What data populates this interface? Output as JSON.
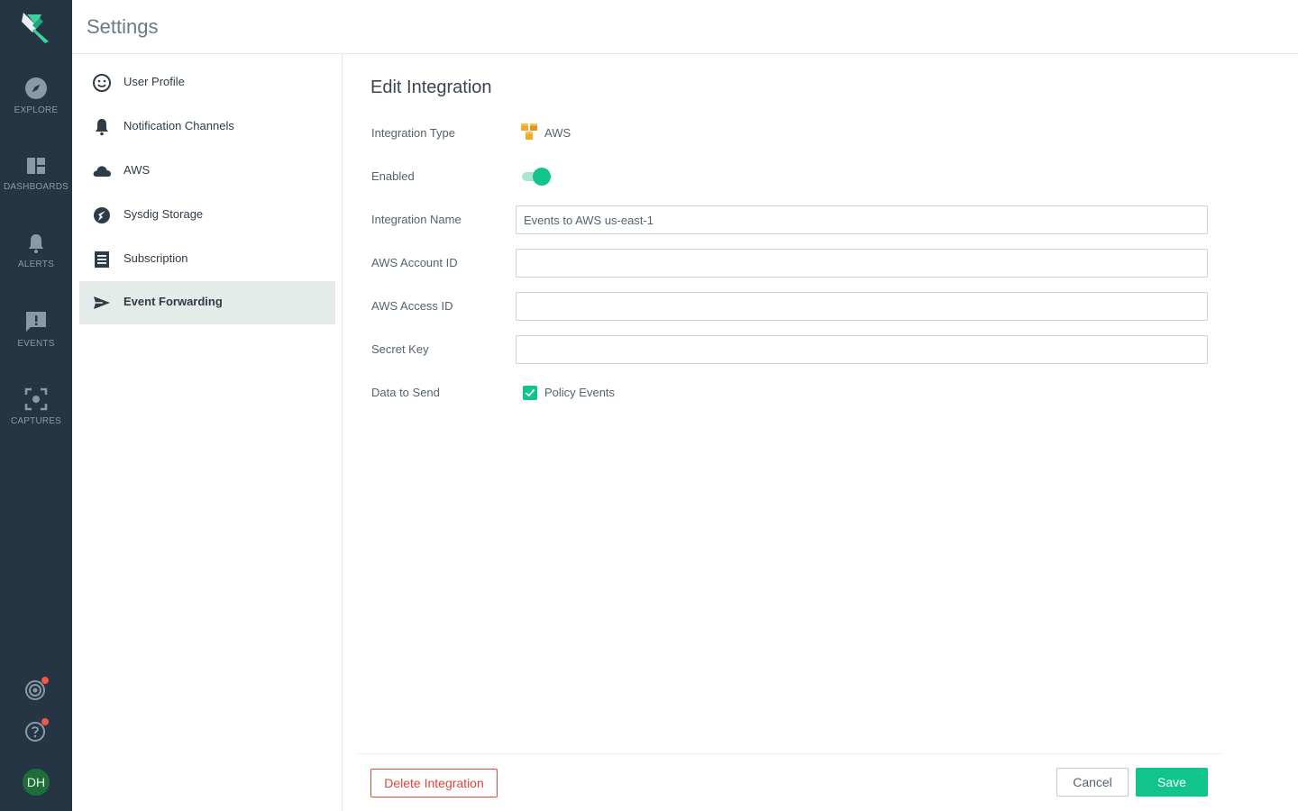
{
  "rail": {
    "items": [
      {
        "label": "EXPLORE",
        "icon": "compass-icon"
      },
      {
        "label": "DASHBOARDS",
        "icon": "dashboard-icon"
      },
      {
        "label": "ALERTS",
        "icon": "bell-icon"
      },
      {
        "label": "EVENTS",
        "icon": "event-alert-icon"
      },
      {
        "label": "CAPTURES",
        "icon": "capture-icon"
      }
    ],
    "avatar_initials": "DH"
  },
  "header": {
    "title": "Settings"
  },
  "settings_nav": {
    "items": [
      {
        "label": "User Profile",
        "icon": "smiley-icon",
        "active": false
      },
      {
        "label": "Notification Channels",
        "icon": "bell-icon",
        "active": false
      },
      {
        "label": "AWS",
        "icon": "cloud-icon",
        "active": false
      },
      {
        "label": "Sysdig Storage",
        "icon": "storage-icon",
        "active": false
      },
      {
        "label": "Subscription",
        "icon": "receipt-icon",
        "active": false
      },
      {
        "label": "Event Forwarding",
        "icon": "send-icon",
        "active": true
      }
    ]
  },
  "form": {
    "title": "Edit Integration",
    "integration_type_label": "Integration Type",
    "integration_type_value": "AWS",
    "enabled_label": "Enabled",
    "enabled": true,
    "integration_name_label": "Integration Name",
    "integration_name_value": "Events to AWS us-east-1",
    "aws_account_id_label": "AWS Account ID",
    "aws_account_id_value": "",
    "aws_access_id_label": "AWS Access ID",
    "aws_access_id_value": "",
    "secret_key_label": "Secret Key",
    "secret_key_value": "",
    "data_to_send_label": "Data to Send",
    "policy_events_label": "Policy Events",
    "policy_events_checked": true
  },
  "footer": {
    "delete_label": "Delete Integration",
    "cancel_label": "Cancel",
    "save_label": "Save"
  },
  "colors": {
    "rail_bg": "#263544",
    "accent": "#10c48c",
    "danger": "#e0453c",
    "aws_orange": "#f5a623",
    "notification_dot": "#ef5a3c"
  }
}
